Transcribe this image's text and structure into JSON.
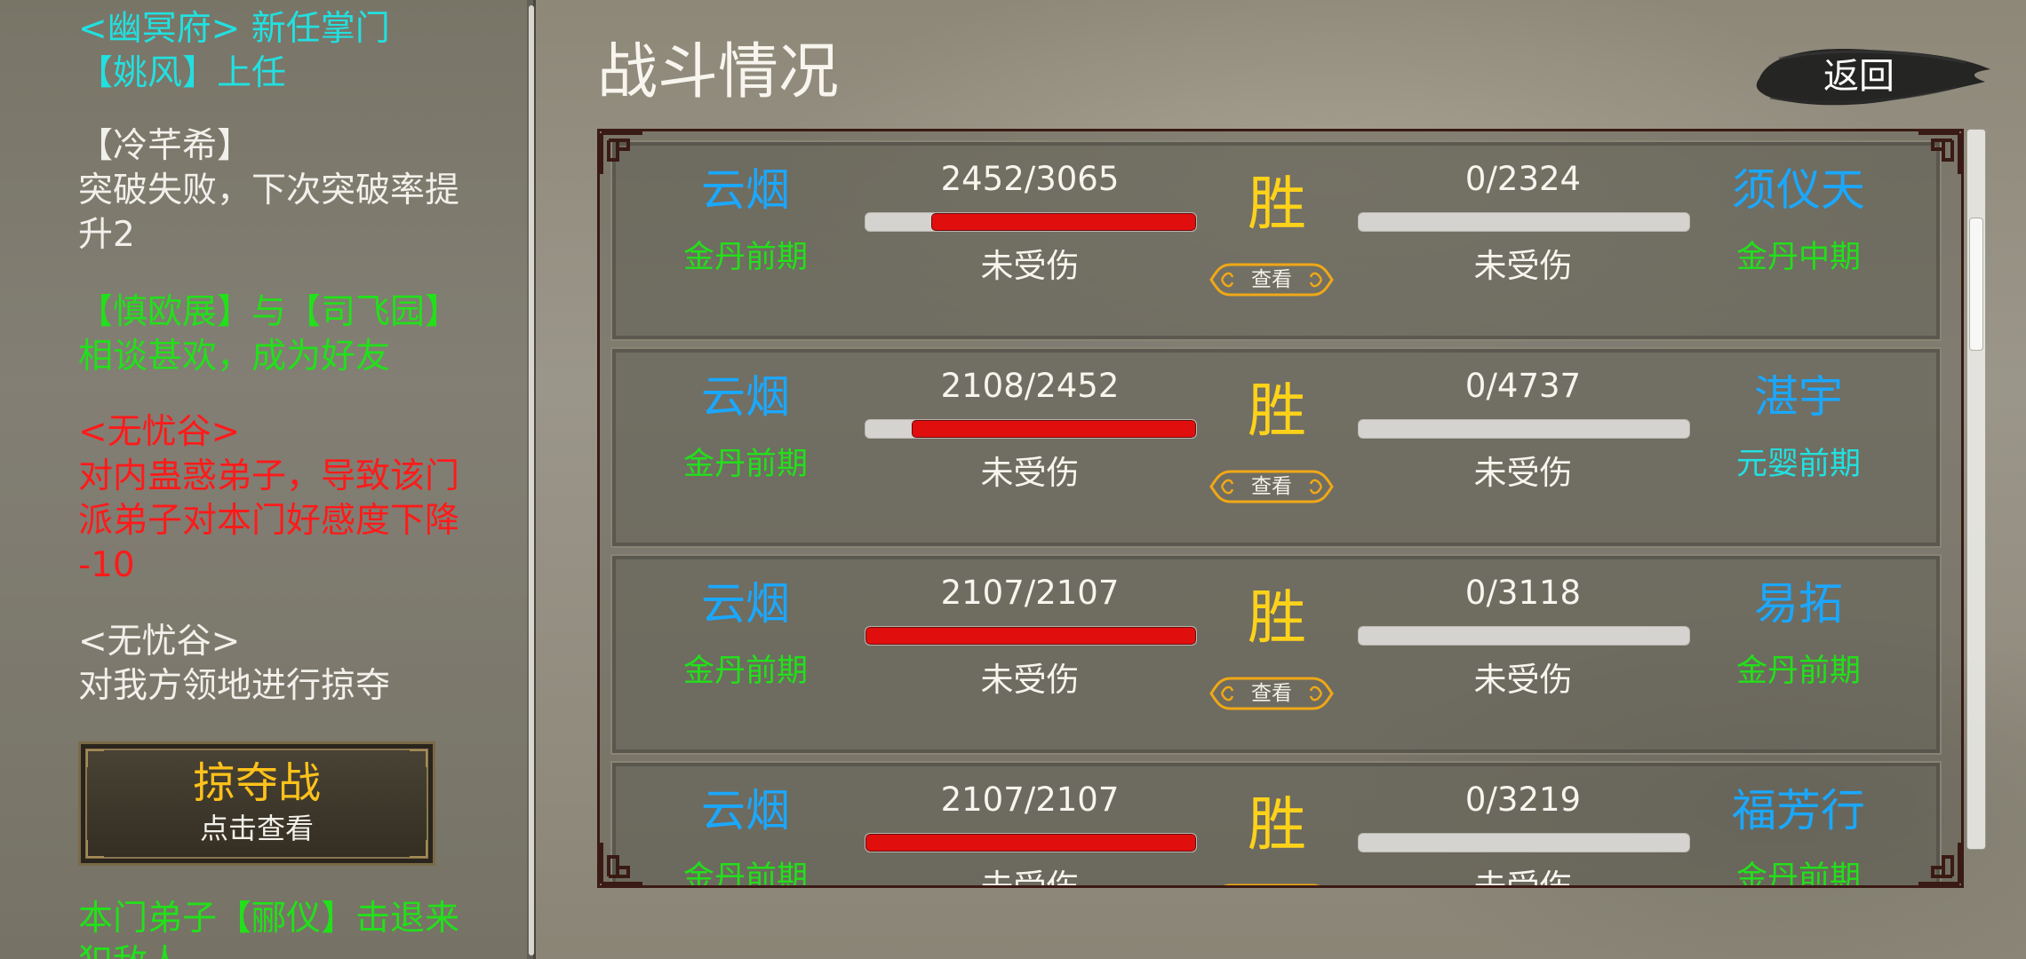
{
  "log": {
    "entries": [
      {
        "lines": [
          "<幽冥府> 新任掌门",
          "【姚风】上任"
        ],
        "color": "#22e0e0"
      },
      {
        "lines": [
          "【冷芊希】",
          "突破失败，下次突破率提",
          "升2"
        ],
        "color": "#f2f0ea"
      },
      {
        "lines": [
          "【慎欧展】与【司飞园】",
          "相谈甚欢，成为好友"
        ],
        "color": "#22e01a"
      },
      {
        "lines": [
          "<无忧谷>",
          "对内蛊惑弟子，导致该门",
          "派弟子对本门好感度下降",
          "-10"
        ],
        "color": "#ff1a1a"
      },
      {
        "lines": [
          "<无忧谷>",
          "对我方领地进行掠夺"
        ],
        "color": "#f2f0ea"
      },
      {
        "lines": [
          "本门弟子【郦仪】击退来",
          "犯敌人"
        ],
        "color": "#22e01a"
      }
    ],
    "raid_button": {
      "title": "掠夺战",
      "subtitle": "点击查看"
    }
  },
  "battle": {
    "title": "战斗情况",
    "back_label": "返回",
    "view_label": "查看",
    "rows": [
      {
        "left_name": "云烟",
        "left_realm": "金丹前期",
        "left_realm_color": "#22e01a",
        "left_hp": "2452/3065",
        "left_hp_fraction": 0.8,
        "left_status": "未受伤",
        "result": "胜",
        "right_name": "须仪天",
        "right_realm": "金丹中期",
        "right_realm_color": "#22e01a",
        "right_hp": "0/2324",
        "right_hp_fraction": 0,
        "right_status": "未受伤"
      },
      {
        "left_name": "云烟",
        "left_realm": "金丹前期",
        "left_realm_color": "#22e01a",
        "left_hp": "2108/2452",
        "left_hp_fraction": 0.86,
        "left_status": "未受伤",
        "result": "胜",
        "right_name": "湛宇",
        "right_realm": "元婴前期",
        "right_realm_color": "#22e0e0",
        "right_hp": "0/4737",
        "right_hp_fraction": 0,
        "right_status": "未受伤"
      },
      {
        "left_name": "云烟",
        "left_realm": "金丹前期",
        "left_realm_color": "#22e01a",
        "left_hp": "2107/2107",
        "left_hp_fraction": 1,
        "left_status": "未受伤",
        "result": "胜",
        "right_name": "易拓",
        "right_realm": "金丹前期",
        "right_realm_color": "#22e01a",
        "right_hp": "0/3118",
        "right_hp_fraction": 0,
        "right_status": "未受伤"
      },
      {
        "left_name": "云烟",
        "left_realm": "金丹前期",
        "left_realm_color": "#22e01a",
        "left_hp": "2107/2107",
        "left_hp_fraction": 1,
        "left_status": "未受伤",
        "result": "胜",
        "right_name": "福芳行",
        "right_realm": "金丹前期",
        "right_realm_color": "#22e01a",
        "right_hp": "0/3219",
        "right_hp_fraction": 0,
        "right_status": "未受伤"
      }
    ]
  }
}
